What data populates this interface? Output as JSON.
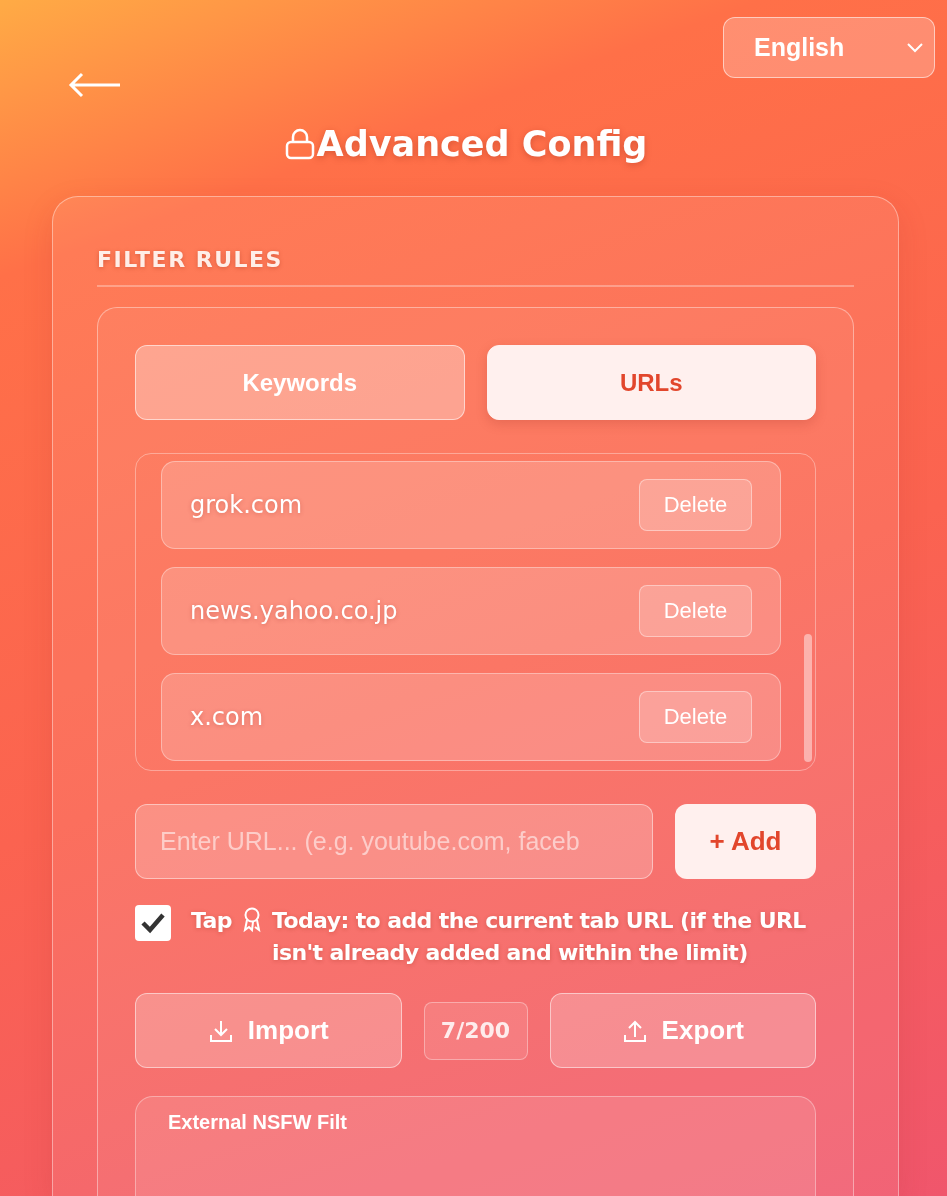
{
  "language_select": {
    "value": "English"
  },
  "title": "Advanced Config",
  "section": {
    "title": "FILTER RULES"
  },
  "tabs": [
    {
      "label": "Keywords",
      "selected": false
    },
    {
      "label": "URLs",
      "selected": true
    }
  ],
  "urls": [
    {
      "text": "grok.com",
      "action": "Delete"
    },
    {
      "text": "news.yahoo.co.jp",
      "action": "Delete"
    },
    {
      "text": "x.com",
      "action": "Delete"
    }
  ],
  "url_input": {
    "placeholder": "Enter URL... (e.g. youtube.com, faceb"
  },
  "add_button": "+ Add",
  "auto_add": {
    "checked": true,
    "prefix": "Tap",
    "text": "Today: to add the current tab URL (if the URL isn't already added and within the limit)"
  },
  "import_button": "Import",
  "count": "7/200",
  "export_button": "Export",
  "nsfw_card": {
    "title": "External NSFW Filt"
  }
}
